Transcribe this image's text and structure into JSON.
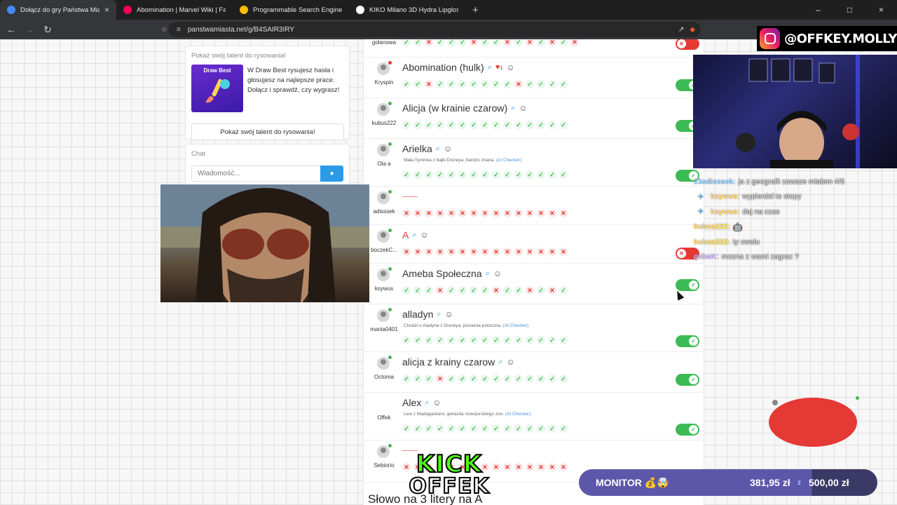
{
  "browser": {
    "tabs": [
      {
        "title": "Dołącz do gry Państwa Miasta",
        "active": true,
        "favicon_color": "#4a8af4"
      },
      {
        "title": "Abomination | Marvel Wiki | Fandom",
        "active": false,
        "favicon_color": "#fa005a"
      },
      {
        "title": "Programmable Search Engine",
        "active": false,
        "favicon_color": "#fbbc05"
      },
      {
        "title": "KIKO Milano 3D Hydra Lipgloss zmię",
        "active": false,
        "favicon_color": "#ffffff"
      }
    ],
    "url": "panstwamiasta.net/g/B4SAIR3IRY"
  },
  "sidebar": {
    "talent_title": "Pokaż swój talent do rysowania!",
    "tile_label": "Draw Best",
    "talent_desc": "W Draw Best rysujesz hasła i głosujesz na najlepsze prace. Dołącz i sprawdź, czy wygrasz!",
    "talent_button": "Pokaż swój talent do rysowania!",
    "chat_title": "Chat",
    "chat_placeholder": "Wiadomość..."
  },
  "answers": [
    {
      "user": "golanowa",
      "word": "",
      "marks": "++x+++x++x+x+x+x",
      "toggle": "off",
      "partial": true
    },
    {
      "user": "Kryspin",
      "word": "Abomination (hulk)",
      "likes": "1",
      "marks": "++x+++++++x++++",
      "toggle": "on",
      "online": "red"
    },
    {
      "user": "kubus222",
      "word": "Alicja (w krainie czarow)",
      "marks": "+++++++++++++++",
      "toggle": "on"
    },
    {
      "user": "Ola a",
      "word": "Arielka",
      "ai": "Mała Syrenka z bajki Disneya, bardzo znana.",
      "marks": "+++++++++++++++",
      "toggle": "on"
    },
    {
      "user": "adisssek",
      "word": "",
      "marks": "xxxxxxxxxxxxxxx",
      "toggle": "",
      "dash": true
    },
    {
      "user": "boczekC...",
      "word": "A",
      "red": true,
      "marks": "xxxxxxxxxxxxxxx",
      "toggle": "off"
    },
    {
      "user": "ksywus",
      "word": "Ameba Społeczna",
      "marks": "+++x++++x++x+x+",
      "toggle": "on"
    },
    {
      "user": "mania0401",
      "word": "alladyn",
      "ai": "Chodzi o Aladyna z Disneya; pisownia potoczna.",
      "marks": "+++++++++++++++",
      "toggle": "on"
    },
    {
      "user": "Octoma",
      "word": "alicja z krainy czarow",
      "marks": "+++x+++++++++++",
      "toggle": "on"
    },
    {
      "user": "Offek",
      "word": "Alex",
      "ai": "Lew z Madagaskaru; gwiazda nowojorskiego zoo.",
      "marks": "+++++++++++++++",
      "toggle": "on",
      "kick": true
    },
    {
      "user": "Sebiorio",
      "word": "",
      "marks": "xxxxxxxxxxxxxxx",
      "toggle": "",
      "dash": true
    }
  ],
  "ai_checker": "(AI Checker)",
  "bottom_title": "Słowo na 3 litery na A",
  "overlay": {
    "instagram": "@OFFKEY.MOLLY",
    "chat": [
      {
        "user": "23adisssek:",
        "text": "ja z geografii zawsze miałem 4/5",
        "color": "#7ec8ff",
        "badge": ""
      },
      {
        "user": "ksywus:",
        "text": "wypierdol te stopy",
        "color": "#ffd24d",
        "badge": "✈"
      },
      {
        "user": "ksywus:",
        "text": "daj na czas",
        "color": "#ffd24d",
        "badge": "✈"
      },
      {
        "user": "kubus222:",
        "text": "🤖",
        "color": "#ffd24d",
        "badge": ""
      },
      {
        "user": "kubus222:",
        "text": "ty cwelu",
        "color": "#ffd24d",
        "badge": ""
      },
      {
        "user": "glibeK:",
        "text": "mozna z wami zagrac ?",
        "color": "#c9a2ff",
        "badge": ""
      }
    ],
    "monitor_label": "MONITOR 💰🤯",
    "monitor_current": "381,95 zł",
    "monitor_goal": "500,00 zł",
    "kick_top": "KICK",
    "kick_bottom": "OFFEK"
  }
}
